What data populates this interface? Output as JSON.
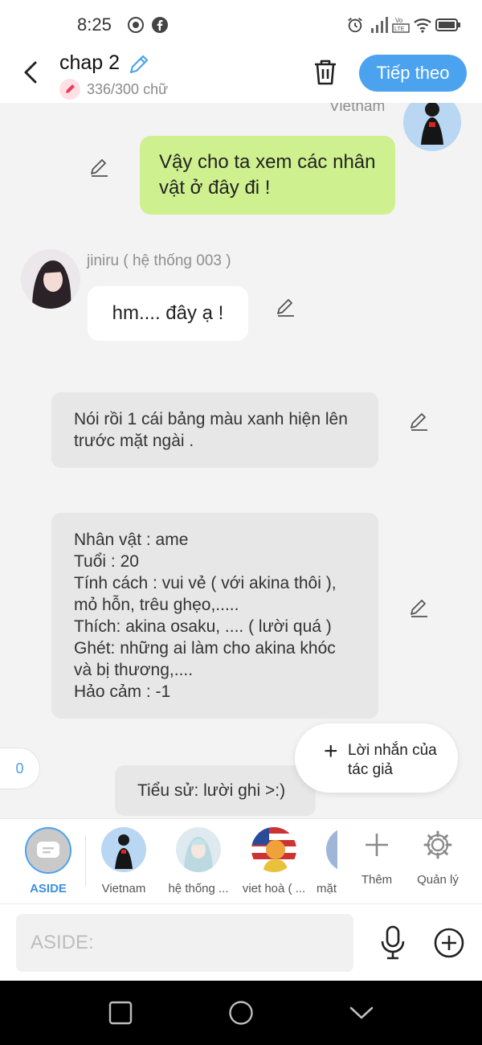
{
  "status_bar": {
    "time": "8:25",
    "icons": [
      "recording-icon",
      "facebook-icon",
      "alarm-icon",
      "signal-icon",
      "volte-icon",
      "wifi-icon",
      "battery-icon"
    ]
  },
  "header": {
    "title": "chap 2",
    "word_count": "336/300 chữ",
    "next_label": "Tiếp theo"
  },
  "messages": {
    "m1": {
      "sender": "Vietnam",
      "text": "Vậy cho ta xem các nhân vật ở đây đi !"
    },
    "m2": {
      "sender": "jiniru ( hệ thống 003 )",
      "text": "hm.... đây ạ !"
    },
    "m3": {
      "text": "Nói rồi 1 cái bảng màu xanh hiện lên trước mặt ngài ."
    },
    "m4": {
      "text": "Nhân vật : ame\nTuổi : 20\nTính cách : vui vẻ ( với akina thôi ), mỏ hỗn, trêu ghẹo,.....\nThích: akina osaku, .... ( lười quá )\nGhét: những ai làm cho akina khóc và bị thương,....\nHảo cảm : -1"
    },
    "m5": {
      "text": "Tiểu sử: lười ghi >:)"
    }
  },
  "counter_badge": "0",
  "author_note": {
    "label": "Lời nhắn của tác giả"
  },
  "characters": {
    "aside": "ASIDE",
    "c1": "Vietnam",
    "c2": "hệ thống ...",
    "c3": "viet hoà ( ...",
    "c4": "mặt",
    "add": "Thêm",
    "manage": "Quản lý"
  },
  "input": {
    "placeholder": "ASIDE:",
    "value": ""
  },
  "colors": {
    "accent": "#4ba3f0",
    "green_bubble": "#cff08f",
    "gray_bubble": "#e7e7e7"
  }
}
